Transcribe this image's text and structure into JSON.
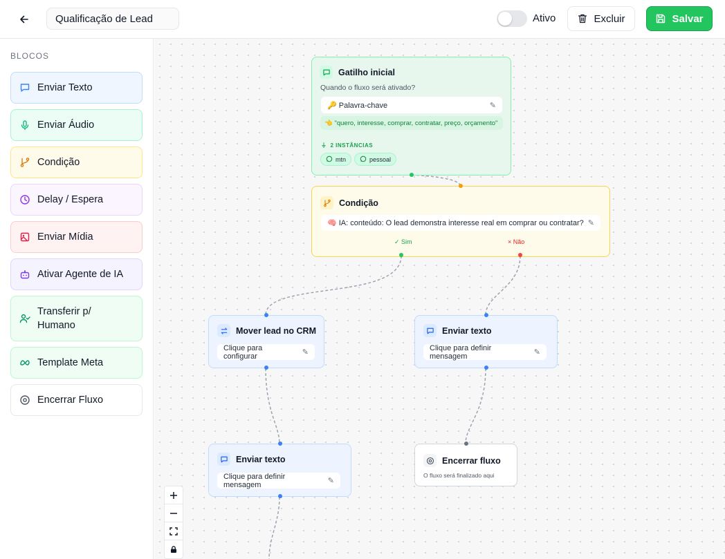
{
  "header": {
    "flow_name": "Qualificação de Lead",
    "toggle_label": "Ativo",
    "toggle_on": false,
    "delete_label": "Excluir",
    "save_label": "Salvar"
  },
  "sidebar": {
    "title": "BLOCOS",
    "items": [
      {
        "label": "Enviar Texto",
        "icon": "message-square-icon"
      },
      {
        "label": "Enviar Áudio",
        "icon": "microphone-icon"
      },
      {
        "label": "Condição",
        "icon": "git-branch-icon"
      },
      {
        "label": "Delay / Espera",
        "icon": "clock-icon"
      },
      {
        "label": "Enviar Mídia",
        "icon": "image-icon"
      },
      {
        "label": "Ativar Agente de IA",
        "icon": "bot-icon"
      },
      {
        "label": "Transferir p/ Humano",
        "icon": "user-check-icon"
      },
      {
        "label": "Template Meta",
        "icon": "meta-icon"
      },
      {
        "label": "Encerrar Fluxo",
        "icon": "stop-circle-icon"
      }
    ]
  },
  "nodes": {
    "trigger": {
      "title": "Gatilho inicial",
      "question": "Quando o fluxo será ativado?",
      "mode": "🔑 Palavra-chave",
      "keywords": "👈 \"quero, interesse, comprar, contratar, preço, orçamento\"",
      "instances_label": "2 INSTÂNCIAS",
      "instances": [
        "mtn",
        "pessoal"
      ]
    },
    "condition": {
      "title": "Condição",
      "expression": "🧠 IA: conteúdo: O lead demonstra interesse real em comprar ou contratar?",
      "yes_label": "✓ Sim",
      "no_label": "× Não"
    },
    "crm": {
      "title": "Mover lead no CRM",
      "action": "Clique para configurar"
    },
    "text_no": {
      "title": "Enviar texto",
      "action": "Clique para definir mensagem"
    },
    "text_yes": {
      "title": "Enviar texto",
      "action": "Clique para definir mensagem"
    },
    "end": {
      "title": "Encerrar fluxo",
      "description": "O fluxo será finalizado aqui"
    }
  },
  "colors": {
    "accent_green": "#22c55e",
    "blue": "#3b82f6",
    "amber": "#f59e0b",
    "red": "#ef4444"
  }
}
